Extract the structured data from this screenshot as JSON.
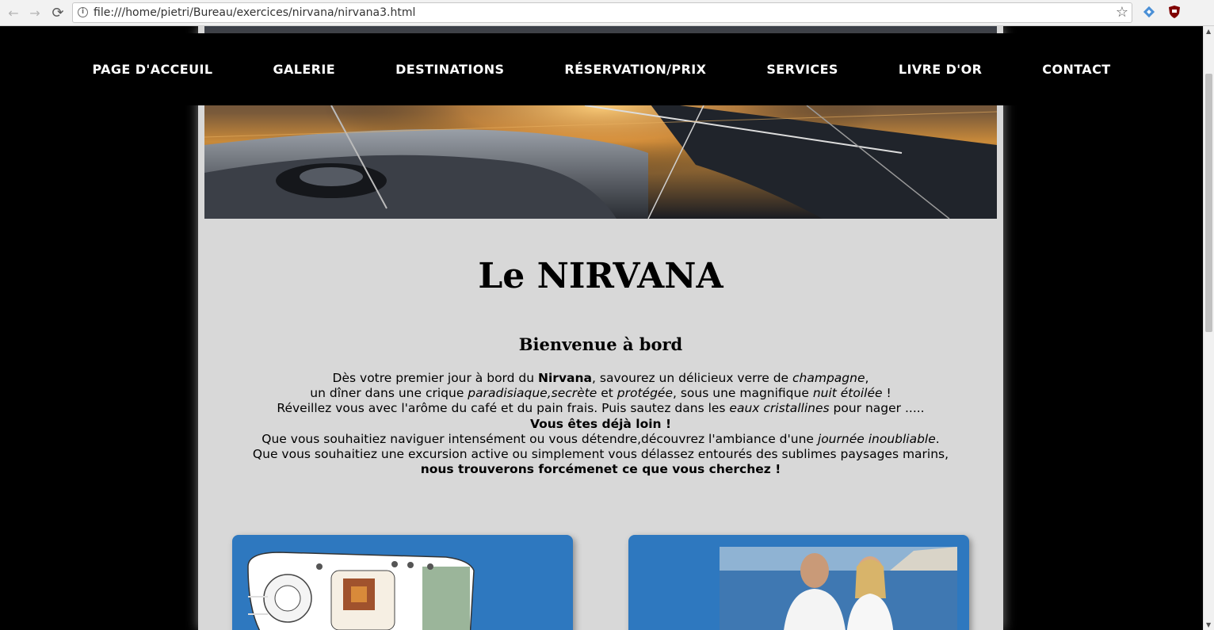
{
  "browser": {
    "url": "file:///home/pietri/Bureau/exercices/nirvana/nirvana3.html",
    "back_icon": "←",
    "forward_icon": "→",
    "reload_icon": "⟳",
    "info_icon": "i",
    "bookmark_icon": "☆"
  },
  "nav": {
    "items": [
      {
        "label": "PAGE D'ACCEUIL"
      },
      {
        "label": "GALERIE"
      },
      {
        "label": "DESTINATIONS"
      },
      {
        "label": "RÉSERVATION/PRIX"
      },
      {
        "label": "SERVICES"
      },
      {
        "label": "LIVRE D'OR"
      },
      {
        "label": "CONTACT"
      }
    ]
  },
  "main": {
    "title": "Le NIRVANA",
    "subtitle": "Bienvenue à bord",
    "intro": {
      "l1_a": "Dès votre premier jour à bord du ",
      "l1_b": "Nirvana",
      "l1_c": ", savourez un délicieux verre de ",
      "l1_d": "champagne",
      "l1_e": ",",
      "l2_a": "un dîner dans une crique ",
      "l2_b": "paradisiaque,secrète",
      "l2_c": " et ",
      "l2_d": "protégée",
      "l2_e": ", sous une magnifique ",
      "l2_f": "nuit étoilée",
      "l2_g": " !",
      "l3_a": "Réveillez vous avec l'arôme du café et du pain frais. Puis sautez dans les ",
      "l3_b": "eaux cristallines",
      "l3_c": " pour nager .....",
      "l4": "Vous êtes déjà loin !",
      "l5_a": "Que vous souhaitiez naviguer intensément ou vous détendre,découvrez l'ambiance d'une ",
      "l5_b": "journée inoubliable",
      "l5_c": ".",
      "l6": "Que vous souhaitiez une excursion active ou simplement vous délassez entourés des sublimes paysages marins,",
      "l7": "nous trouverons forcémenet ce que vous cherchez !"
    }
  },
  "colors": {
    "page_bg": "#000000",
    "content_bg": "#d8d8d8",
    "nav_bg": "#000000",
    "nav_text": "#ffffff",
    "card_bg": "#2e78bf"
  }
}
